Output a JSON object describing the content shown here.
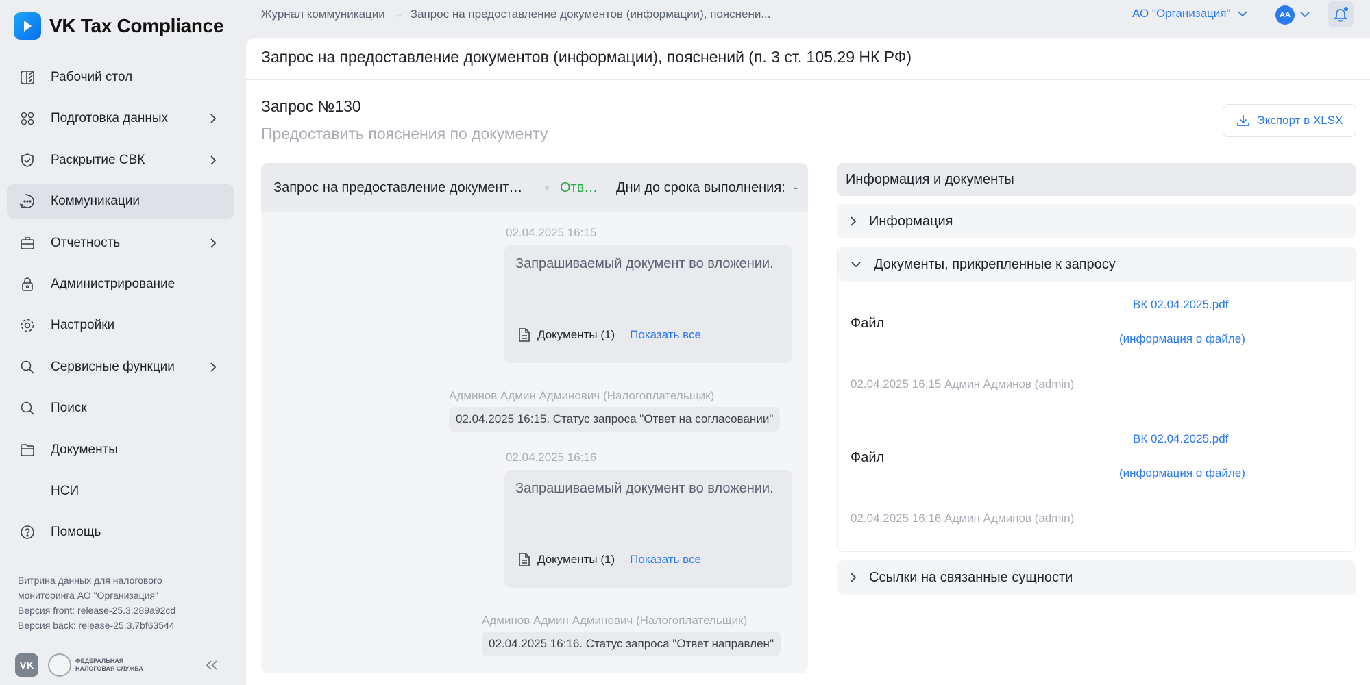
{
  "app": {
    "name": "VK Tax Compliance"
  },
  "sidebar": {
    "items": [
      {
        "label": "Рабочий стол",
        "icon": "desk-icon"
      },
      {
        "label": "Подготовка данных",
        "icon": "data-prep-icon"
      },
      {
        "label": "Раскрытие СВК",
        "icon": "shield-check-icon"
      },
      {
        "label": "Коммуникации",
        "icon": "chat-icon"
      },
      {
        "label": "Отчетность",
        "icon": "briefcase-icon"
      },
      {
        "label": "Администрирование",
        "icon": "lock-icon"
      },
      {
        "label": "Настройки",
        "icon": "gear-icon"
      },
      {
        "label": "Сервисные функции",
        "icon": "service-icon"
      },
      {
        "label": "Поиск",
        "icon": "search-icon"
      },
      {
        "label": "Документы",
        "icon": "folder-icon"
      },
      {
        "label": "НСИ",
        "icon": ""
      },
      {
        "label": "Помощь",
        "icon": "help-icon"
      }
    ],
    "info_line1": "Витрина данных для налогового",
    "info_line2": "мониторинга АО \"Организация\"",
    "version_front": "Версия front: release-25.3.289a92cd",
    "version_back": "Версия back: release-25.3.7bf63544",
    "fns_line1": "ФЕДЕРАЛЬНАЯ",
    "fns_line2": "НАЛОГОВАЯ СЛУЖБА"
  },
  "topbar": {
    "breadcrumb_1": "Журнал коммуникации",
    "breadcrumb_arrow": "→",
    "breadcrumb_2": "Запрос на предоставление документов (информации), пояснени...",
    "org": "АО \"Организация\"",
    "avatar_initials": "АА"
  },
  "page": {
    "title": "Запрос на предоставление документов (информации), пояснений (п. 3 ст. 105.29 НК РФ)",
    "request_number": "Запрос №130",
    "request_subtitle": "Предоставить пояснения по документу",
    "export_label": "Экспорт в XLSX"
  },
  "chat": {
    "header_title": "Запрос на предоставление документов (информации), пояснений",
    "header_status": "Ответ направлен",
    "days_label": "Дни до срока выполнения:",
    "days_value": "-",
    "messages": [
      {
        "time": "02.04.2025 16:15",
        "text": "Запрашиваемый документ во вложении.",
        "docs_label": "Документы (1)",
        "show_all": "Показать все",
        "author": "Админов Админ Админович  (Налогоплательщик)",
        "status": "02.04.2025 16:15. Статус запроса \"Ответ на согласовании\""
      },
      {
        "time": "02.04.2025 16:16",
        "text": "Запрашиваемый документ во вложении.",
        "docs_label": "Документы (1)",
        "show_all": "Показать все",
        "author": "Админов Админ Админович  (Налогоплательщик)",
        "status": "02.04.2025 16:16. Статус запроса \"Ответ направлен\""
      }
    ]
  },
  "info_panel": {
    "header": "Информация и документы",
    "section_info": "Информация",
    "section_docs": "Документы, прикрепленные к запросу",
    "section_links": "Ссылки на связанные сущности",
    "files": [
      {
        "label": "Файл",
        "name": "ВК 02.04.2025.pdf",
        "info_link": "(информация о файле)",
        "meta": "02.04.2025 16:15 Админ Админов (admin)"
      },
      {
        "label": "Файл",
        "name": "ВК 02.04.2025.pdf",
        "info_link": "(информация о файле)",
        "meta": "02.04.2025 16:16 Админ Админов (admin)"
      }
    ]
  },
  "colors": {
    "accent": "#2a7af0",
    "status_green": "#27a745",
    "sidebar_bg": "#edeef1",
    "active_item_bg": "#dfe1e6"
  }
}
